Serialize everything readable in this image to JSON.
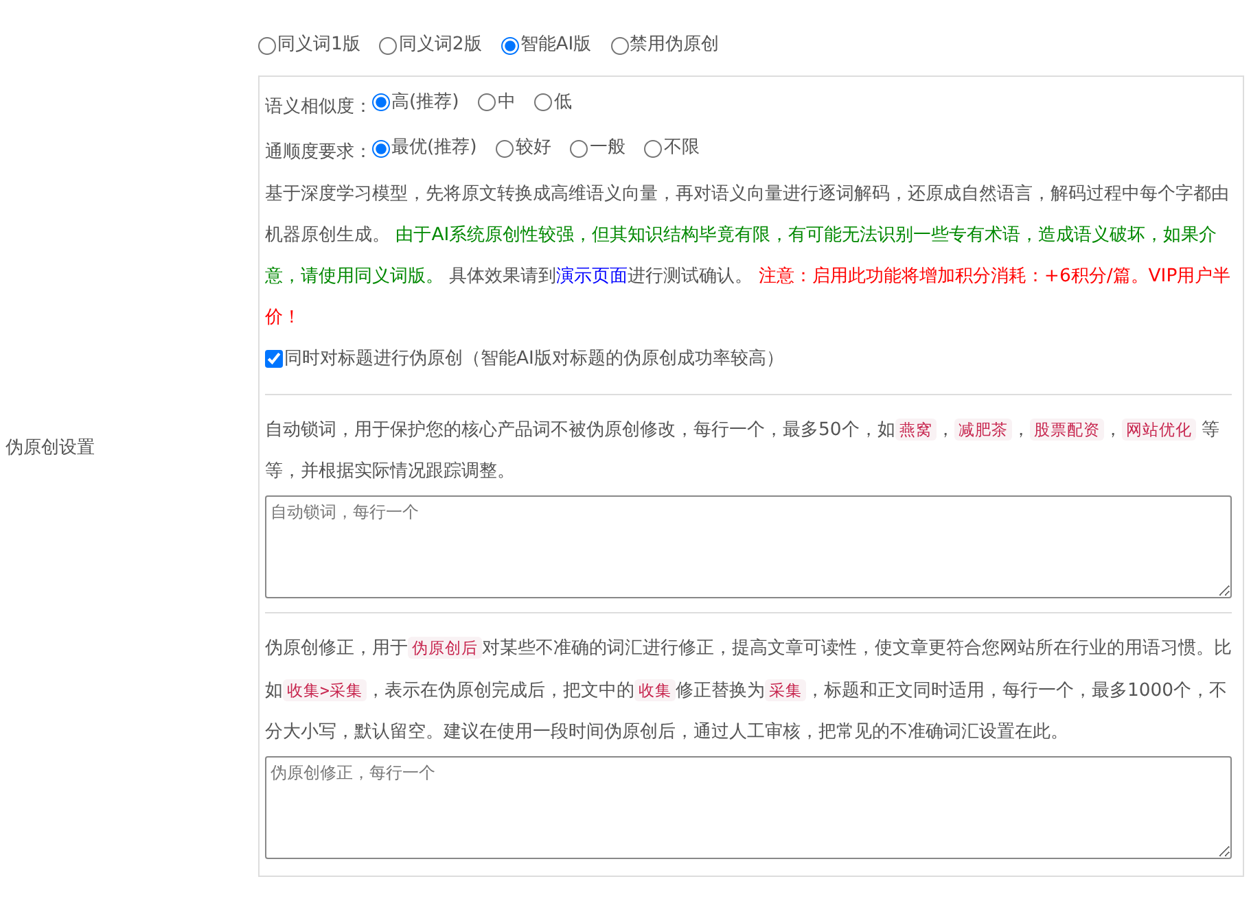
{
  "label": "伪原创设置",
  "modes": [
    {
      "label": "同义词1版",
      "selected": false
    },
    {
      "label": "同义词2版",
      "selected": false
    },
    {
      "label": "智能AI版",
      "selected": true
    },
    {
      "label": "禁用伪原创",
      "selected": false
    }
  ],
  "similarity": {
    "label": "语义相似度：",
    "options": [
      {
        "label": "高(推荐)",
        "selected": true
      },
      {
        "label": "中",
        "selected": false
      },
      {
        "label": "低",
        "selected": false
      }
    ]
  },
  "fluency": {
    "label": "通顺度要求：",
    "options": [
      {
        "label": "最优(推荐)",
        "selected": true
      },
      {
        "label": "较好",
        "selected": false
      },
      {
        "label": "一般",
        "selected": false
      },
      {
        "label": "不限",
        "selected": false
      }
    ]
  },
  "ai_description": [
    {
      "kind": "plain",
      "text": "基于深度学习模型，先将原文转换成高维语义向量，再对语义向量进行逐词解码，还原成自然语言，解码过程中每个字都由机器原创生成。 "
    },
    {
      "kind": "green",
      "text": "由于AI系统原创性较强，但其知识结构毕竟有限，有可能无法识别一些专有术语，造成语义破坏，如果介意，请使用同义词版。"
    },
    {
      "kind": "plain",
      "text": " 具体效果请到"
    },
    {
      "kind": "link",
      "text": "演示页面"
    },
    {
      "kind": "plain",
      "text": "进行测试确认。 "
    },
    {
      "kind": "red",
      "text": "注意：启用此功能将增加积分消耗：+6积分/篇。VIP用户半价！"
    }
  ],
  "title_option": {
    "label": "同时对标题进行伪原创（智能AI版对标题的伪原创成功率较高）",
    "checked": true
  },
  "lock_words": {
    "description": [
      {
        "kind": "plain",
        "text": "自动锁词，用于保护您的核心产品词不被伪原创修改，每行一个，最多50个，如"
      },
      {
        "kind": "code",
        "text": "燕窝"
      },
      {
        "kind": "plain",
        "text": "，"
      },
      {
        "kind": "code",
        "text": "减肥茶"
      },
      {
        "kind": "plain",
        "text": "，"
      },
      {
        "kind": "code",
        "text": "股票配资"
      },
      {
        "kind": "plain",
        "text": "，"
      },
      {
        "kind": "code",
        "text": "网站优化"
      },
      {
        "kind": "plain",
        "text": " 等等，并根据实际情况跟踪调整。"
      }
    ],
    "placeholder": "自动锁词，每行一个"
  },
  "corrections": {
    "description": [
      {
        "kind": "plain",
        "text": "伪原创修正，用于"
      },
      {
        "kind": "code",
        "text": "伪原创后"
      },
      {
        "kind": "plain",
        "text": "对某些不准确的词汇进行修正，提高文章可读性，使文章更符合您网站所在行业的用语习惯。比如"
      },
      {
        "kind": "code",
        "text": "收集>采集"
      },
      {
        "kind": "plain",
        "text": "，表示在伪原创完成后，把文中的"
      },
      {
        "kind": "code",
        "text": "收集"
      },
      {
        "kind": "plain",
        "text": "修正替换为"
      },
      {
        "kind": "code",
        "text": "采集"
      },
      {
        "kind": "plain",
        "text": "，标题和正文同时适用，每行一个，最多1000个，不分大小写，默认留空。建议在使用一段时间伪原创后，通过人工审核，把常见的不准确词汇设置在此。"
      }
    ],
    "placeholder": "伪原创修正，每行一个"
  }
}
